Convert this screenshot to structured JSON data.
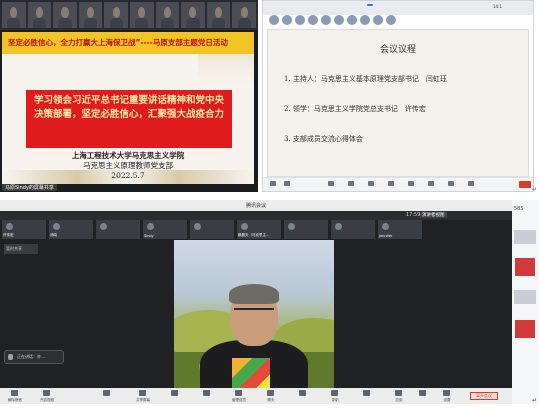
{
  "top_left": {
    "participants": [
      "",
      "",
      "",
      "",
      "",
      "",
      "",
      "",
      "",
      ""
    ],
    "slide": {
      "banner": "坚定必胜信心，全力打赢大上海保卫战”----马原支部主题党日活动",
      "red_text": "学习领会习近平总书记重要讲话精神和党中央决策部署，坚定必胜信心，汇聚强大战疫合力",
      "org": "上海工程技术大学马克思主义学院",
      "branch": "马克思主义原理教师党支部",
      "date": "2022.5.7"
    },
    "presenter_label": "马原Sindy的屏幕共享"
  },
  "top_right": {
    "share_title": "",
    "time": "14:1",
    "slide": {
      "title": "会议议程",
      "items": [
        "1. 主持人：马克思主义基本原理党支部书记　闫虹珏",
        "2. 领学：马克思主义学院党总支书记　许传宏",
        "3. 支部成员交流心得体会"
      ]
    }
  },
  "bottom": {
    "window_title": "腾讯会议",
    "time": "17:59",
    "view_mode": "演讲者视图",
    "participants": [
      "许传宏",
      "汤晓",
      "",
      "Sindy",
      "",
      "赖晨天（马克思主…",
      "",
      "",
      "jennifer"
    ],
    "small_window": "暂时共享",
    "speaker_label": "正在讲话：许…",
    "controls": [
      "解除静音",
      "开启视频",
      "",
      "共享屏幕",
      "",
      "",
      "管理成员",
      "聊天",
      "",
      "录制",
      "",
      "应用",
      "",
      "设置"
    ],
    "end_button": "离开会议"
  },
  "right_side": {
    "number": "585"
  }
}
